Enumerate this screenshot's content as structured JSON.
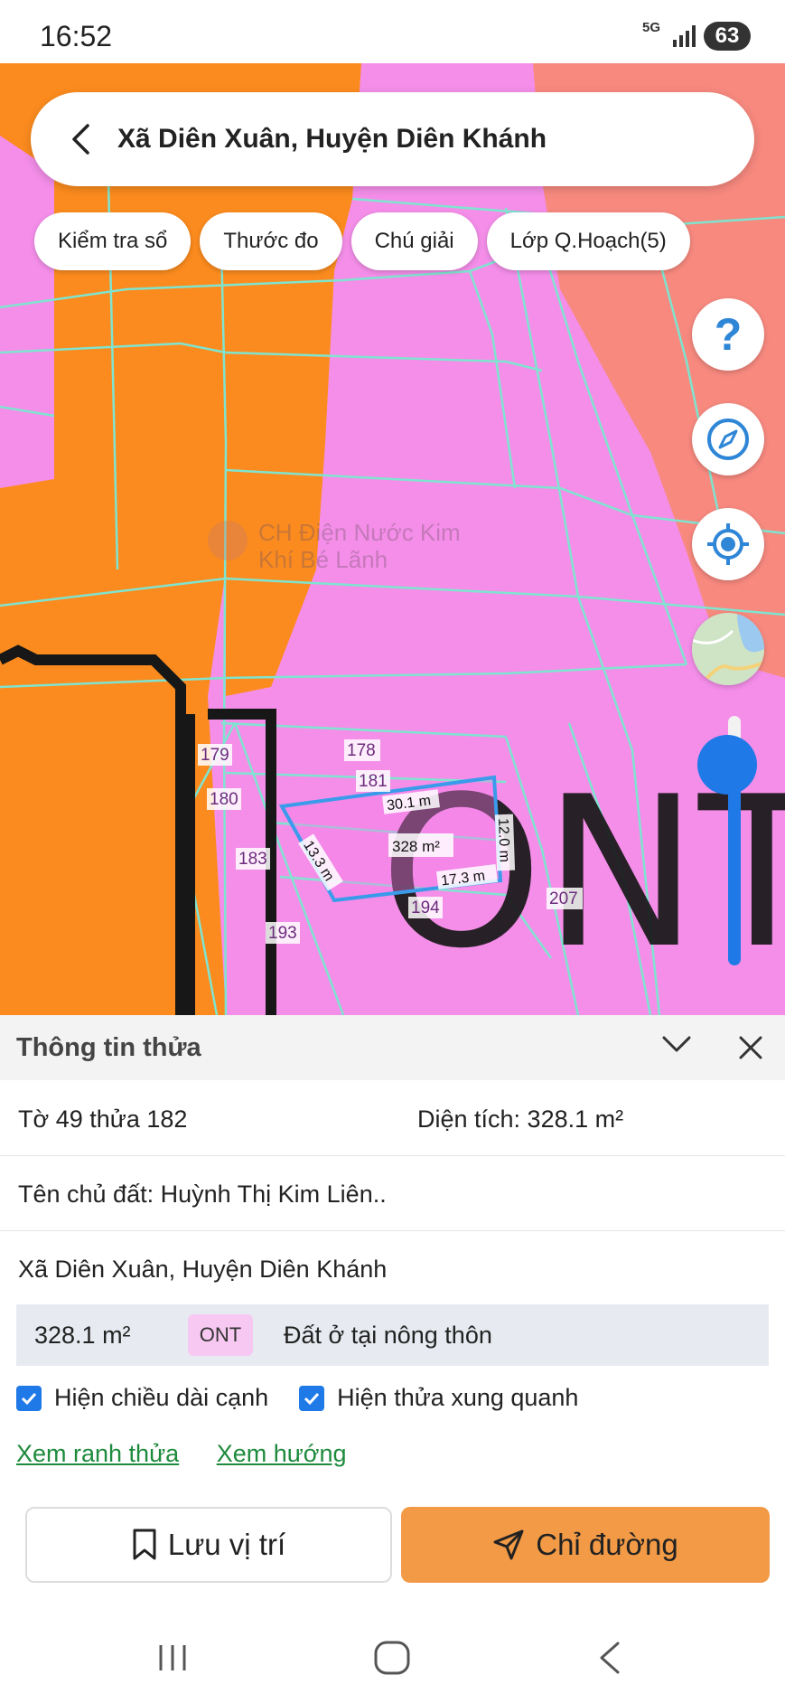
{
  "status_bar": {
    "time": "16:52",
    "network": "5G",
    "battery": "63"
  },
  "search": {
    "title": "Xã Diên Xuân, Huyện Diên Khánh"
  },
  "chips": [
    {
      "label": "Kiểm tra sổ"
    },
    {
      "label": "Thước đo"
    },
    {
      "label": "Chú giải"
    },
    {
      "label": "Lớp Q.Hoạch(5)"
    }
  ],
  "map": {
    "zoom_level": 0.92,
    "colors": {
      "orange": "#fb8b1e",
      "pink": "#f48ee9",
      "salmon": "#f7897f",
      "parcel_line": "#7fe4cf",
      "selected_outline": "#3a9bea"
    },
    "labels": {
      "ont": "ONT",
      "poi": "CH Điện Nước Kim Khí Bé Lãnh",
      "poi_line1": "CH Điện Nước Kim",
      "poi_line2": "Khí Bé Lãnh"
    },
    "parcels": [
      "179",
      "178",
      "180",
      "181",
      "183",
      "194",
      "207",
      "193"
    ],
    "edges": {
      "top": "30.1 m",
      "right": "12.0 m",
      "bottom": "17.3 m",
      "left": "13.3 m"
    },
    "area_label": "328 m²"
  },
  "sheet": {
    "title": "Thông tin thửa",
    "sheet_parcel": "Tờ 49 thửa 182",
    "area_label": "Diện tích: 328.1 m²",
    "owner": "Tên chủ đất: Huỳnh Thị Kim Liên..",
    "address": "Xã Diên Xuân, Huyện Diên Khánh",
    "land_area": "328.1 m²",
    "land_code": "ONT",
    "land_desc": "Đất ở tại nông thôn",
    "check_edges": "Hiện chiều dài cạnh",
    "check_neighbors": "Hiện thửa xung quanh",
    "link_boundary": "Xem ranh thửa",
    "link_direction": "Xem hướng",
    "save_label": "Lưu vị trí",
    "route_label": "Chỉ đường"
  }
}
